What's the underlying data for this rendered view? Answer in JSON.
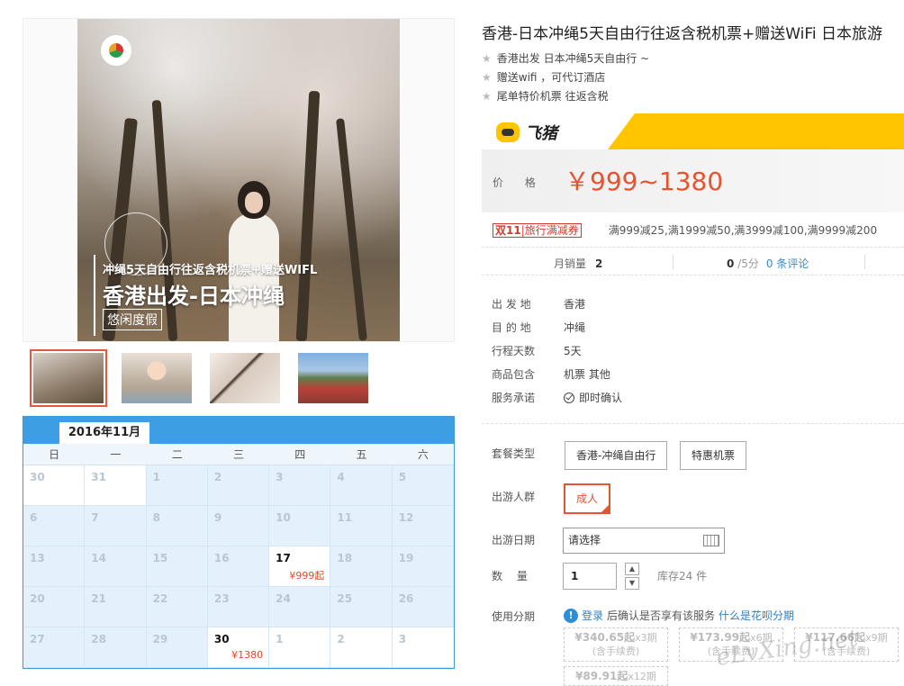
{
  "product": {
    "title": "香港-日本冲绳5天自由行往返含税机票+赠送WiFi 日本旅游",
    "highlights": [
      "香港出发 日本冲绳5天自由行 ~",
      "赠送wifi ，可代订酒店",
      "尾单特价机票 往返含税"
    ]
  },
  "image": {
    "subtitle": "冲绳5天自由行往返含税机票+赠送WIFL",
    "title": "香港出发-日本冲绳",
    "tag": "悠闲度假"
  },
  "calendar": {
    "month": "2016年11月",
    "weekdays": [
      "日",
      "一",
      "二",
      "三",
      "四",
      "五",
      "六"
    ],
    "days": [
      "30",
      "31",
      "1",
      "2",
      "3",
      "4",
      "5",
      "6",
      "7",
      "8",
      "9",
      "10",
      "11",
      "12",
      "13",
      "14",
      "15",
      "16",
      "17",
      "18",
      "19",
      "20",
      "21",
      "22",
      "23",
      "24",
      "25",
      "26",
      "27",
      "28",
      "29",
      "30",
      "1",
      "2",
      "3"
    ],
    "prices": {
      "17": "¥999起",
      "30": "¥1380"
    }
  },
  "brand": {
    "name": "飞猪",
    "accent": "#ffc600"
  },
  "price": {
    "label": "价 格",
    "value": "￥999~1380",
    "color": "#e4542f"
  },
  "promo": {
    "badge_prefix": "双11",
    "badge_text": "旅行满减券",
    "text": "满999减25,满1999减50,满3999减100,满9999减200"
  },
  "stats": {
    "sales_label": "月销量",
    "sales_value": "2",
    "score": "0",
    "score_suffix": "/5分",
    "reviews": "0 条评论"
  },
  "info": [
    {
      "key": "出 发 地",
      "value": "香港"
    },
    {
      "key": "目 的 地",
      "value": "冲绳"
    },
    {
      "key": "行程天数",
      "value": "5天"
    },
    {
      "key": "商品包含",
      "value": "机票  其他"
    },
    {
      "key": "服务承诺",
      "value": "即时确认"
    }
  ],
  "options": {
    "package_label": "套餐类型",
    "packages": [
      "香港-冲绳自由行",
      "特惠机票"
    ],
    "traveler_label": "出游人群",
    "traveler": "成人",
    "date_label": "出游日期",
    "date_placeholder": "请选择",
    "qty_label": "数　 量",
    "qty_value": "1",
    "stock": "库存24 件",
    "installment_label": "使用分期",
    "installment_login": "登录",
    "installment_text": "后确认是否享有该服务",
    "installment_link": "什么是花呗分期"
  },
  "installments": [
    {
      "amount": "¥340.65起",
      "period": "x3期",
      "fee": "(含手续费)"
    },
    {
      "amount": "¥173.99起",
      "period": "x6期",
      "fee": "(含手续费)"
    },
    {
      "amount": "¥117.66起",
      "period": "x9期",
      "fee": "(含手续费)"
    },
    {
      "amount": "¥89.91起",
      "period": "x12期",
      "fee": ""
    }
  ],
  "watermark": "eLvXing.net"
}
